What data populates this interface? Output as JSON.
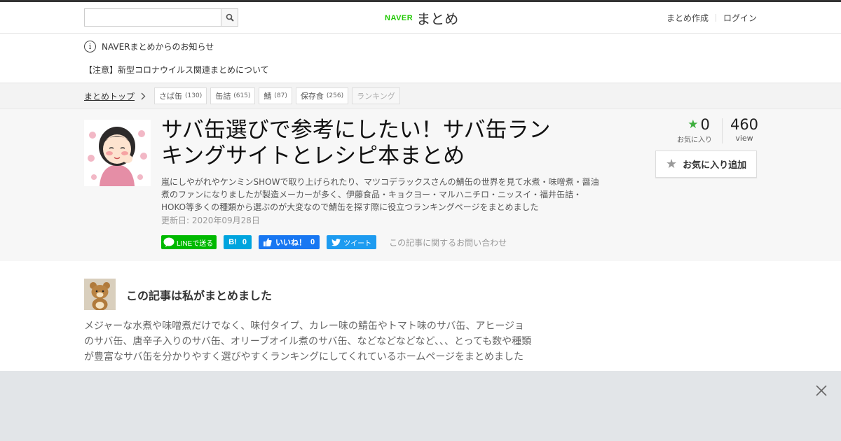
{
  "header": {
    "search_placeholder": "",
    "logo_naver": "NAVER",
    "logo_matome": "まとめ",
    "links": [
      "まとめ作成",
      "ログイン"
    ]
  },
  "notice": {
    "title": "NAVERまとめからのお知らせ",
    "message": "【注意】新型コロナウイルス関連まとめについて"
  },
  "breadcrumb": {
    "top": "まとめトップ",
    "tags": [
      {
        "label": "さば缶",
        "count": "(130)"
      },
      {
        "label": "缶詰",
        "count": "(615)"
      },
      {
        "label": "鯖",
        "count": "(87)"
      },
      {
        "label": "保存食",
        "count": "(256)"
      }
    ],
    "ranking": "ランキング"
  },
  "article": {
    "title_line1": "サバ缶選びで参考にしたい！サバ缶ラン",
    "title_line2": "キングサイトとレシピ本まとめ",
    "description": "嵐にしやがれやケンミンSHOWで取り上げられたり、マツコデラックスさんの鯖缶の世界を見て水煮・味噌煮・醤油煮のファンになりましたが製造メーカーが多く、伊藤食品・キョクヨー・マルハニチロ・ニッスイ・福井缶詰・HOKO等多くの種類から選ぶのが大変なので鯖缶を探す際に役立つランキングページをまとめました",
    "updated": "更新日: 2020年09月28日",
    "share": {
      "line": "LINEで送る",
      "hatena_label": "B!",
      "hatena_count": "0",
      "fb_label": "いいね！",
      "fb_count": "0",
      "tweet": "ツイート",
      "contact": "この記事に関するお問い合わせ"
    },
    "stats": {
      "fav_count": "0",
      "fav_label": "お気に入り",
      "view_count": "460",
      "view_label": "view"
    },
    "fav_button": "お気に入り追加"
  },
  "author": {
    "heading": "この記事は私がまとめました",
    "text": "メジャーな水煮や味噌煮だけでなく、味付タイプ、カレー味の鯖缶やトマト味のサバ缶、アヒージョのサバ缶、唐辛子入りのサバ缶、オリーブオイル煮のサバ缶、などなどなどなど、、、とっても数や種類が豊富なサバ缶を分かりやすく選びやすくランキングにしてくれているホームページをまとめました"
  },
  "colors": {
    "naver_green": "#1ec800",
    "line_green": "#00b900",
    "hatena_blue": "#00a4de",
    "facebook_blue": "#1877f2",
    "twitter_blue": "#1d9bf0",
    "fav_star_green": "#3eaf3e"
  },
  "icons": [
    "search-icon",
    "info-icon",
    "chevron-right-icon",
    "star-icon",
    "line-icon",
    "facebook-thumb-icon",
    "twitter-bird-icon",
    "close-icon"
  ]
}
